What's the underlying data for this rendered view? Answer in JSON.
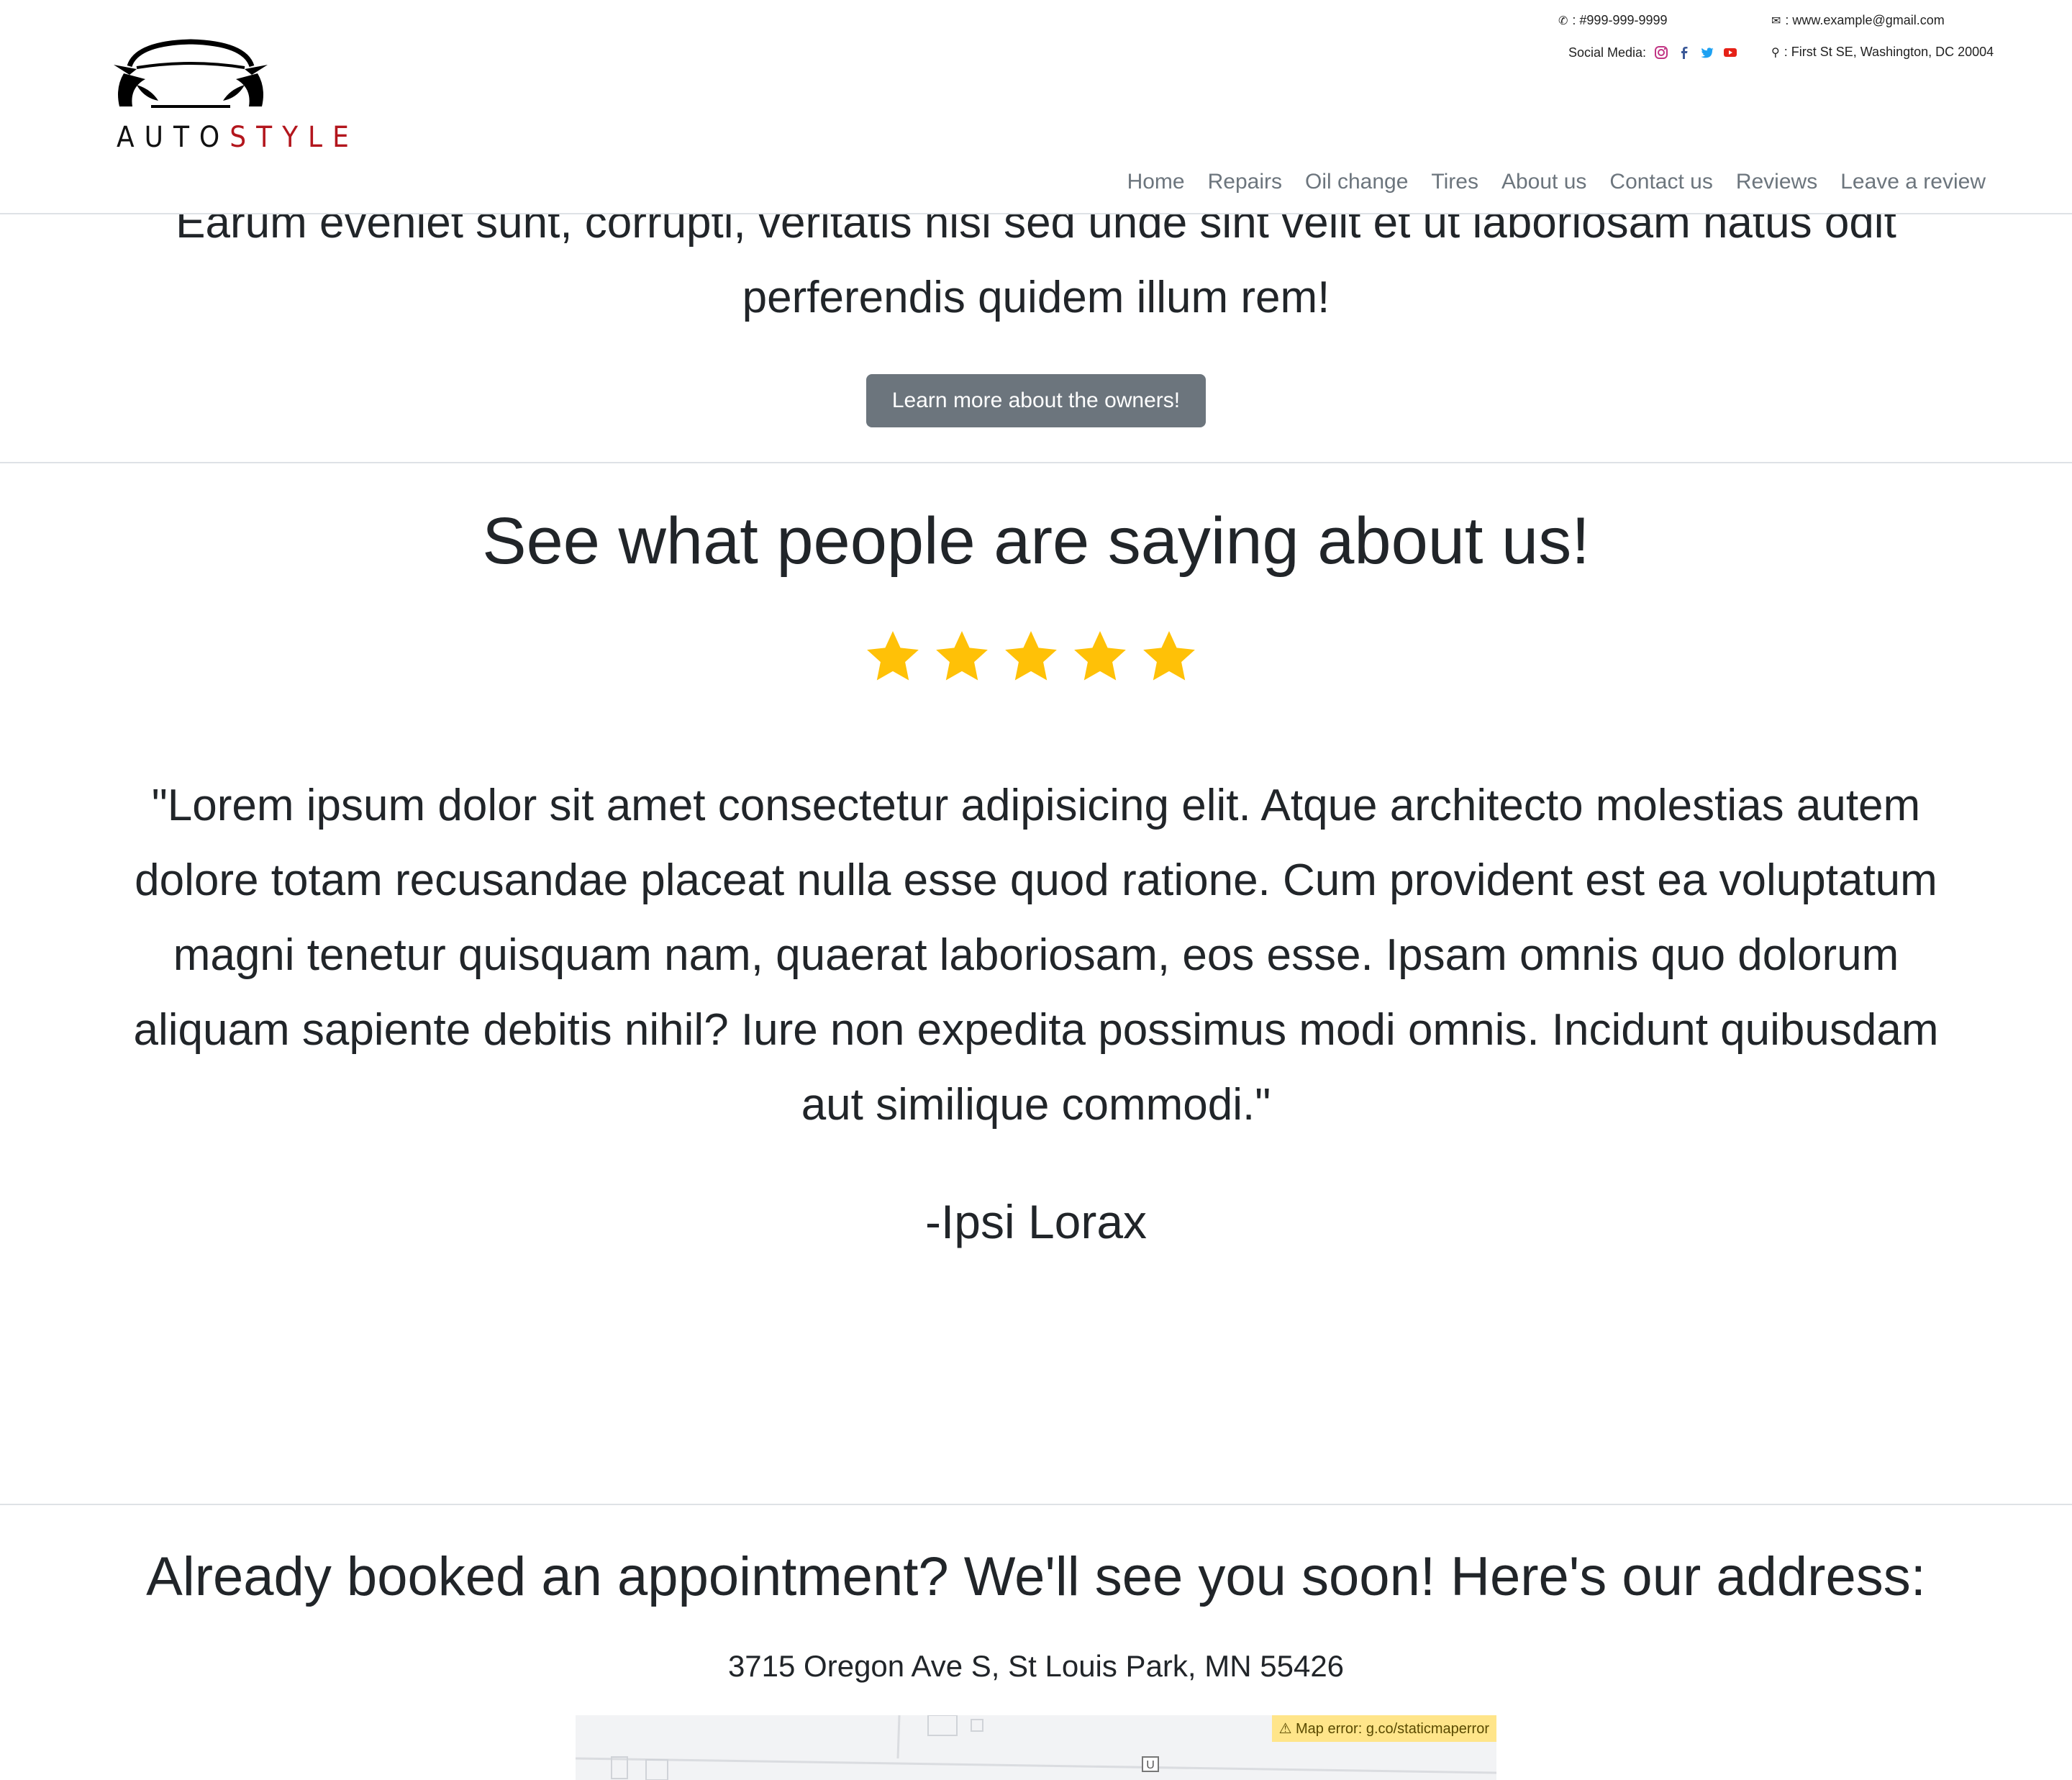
{
  "header": {
    "logo_text_a": "AUTO",
    "logo_text_b": "STYLE",
    "phone": ": #999-999-9999",
    "email": ": www.example@gmail.com",
    "social_label": "Social Media:",
    "address": ": First St SE, Washington, DC 20004",
    "icons": {
      "phone": "phone-icon",
      "email": "envelope-icon",
      "address": "map-pin-icon",
      "social": [
        "instagram-icon",
        "facebook-icon",
        "twitter-icon",
        "youtube-icon"
      ]
    }
  },
  "nav": {
    "items": [
      "Home",
      "Repairs",
      "Oil change",
      "Tires",
      "About us",
      "Contact us",
      "Reviews",
      "Leave a review"
    ]
  },
  "owners": {
    "text": "Earum eveniet sunt, corrupti, veritatis nisi sed unde sint velit et ut laboriosam natus odit perferendis quidem illum rem!",
    "button": "Learn more about the owners!"
  },
  "reviews": {
    "title": "See what people are saying about us!",
    "rating": 5,
    "quote": "\"Lorem ipsum dolor sit amet consectetur adipisicing elit. Atque architecto molestias autem dolore totam recusandae placeat nulla esse quod ratione. Cum provident est ea voluptatum magni tenetur quisquam nam, quaerat laboriosam, eos esse. Ipsam omnis quo dolorum aliquam sapiente debitis nihil? Iure non expedita possimus modi omnis. Incidunt quibusdam aut similique commodi.\"",
    "author": "-Ipsi Lorax"
  },
  "location": {
    "title": "Already booked an appointment? We'll see you soon! Here's our address:",
    "address": "3715 Oregon Ave S, St Louis Park, MN 55426",
    "map_error": "⚠ Map error: g.co/staticmaperror"
  },
  "colors": {
    "star": "#ffc107",
    "button": "#6c757d",
    "logo_accent": "#b3161d"
  }
}
